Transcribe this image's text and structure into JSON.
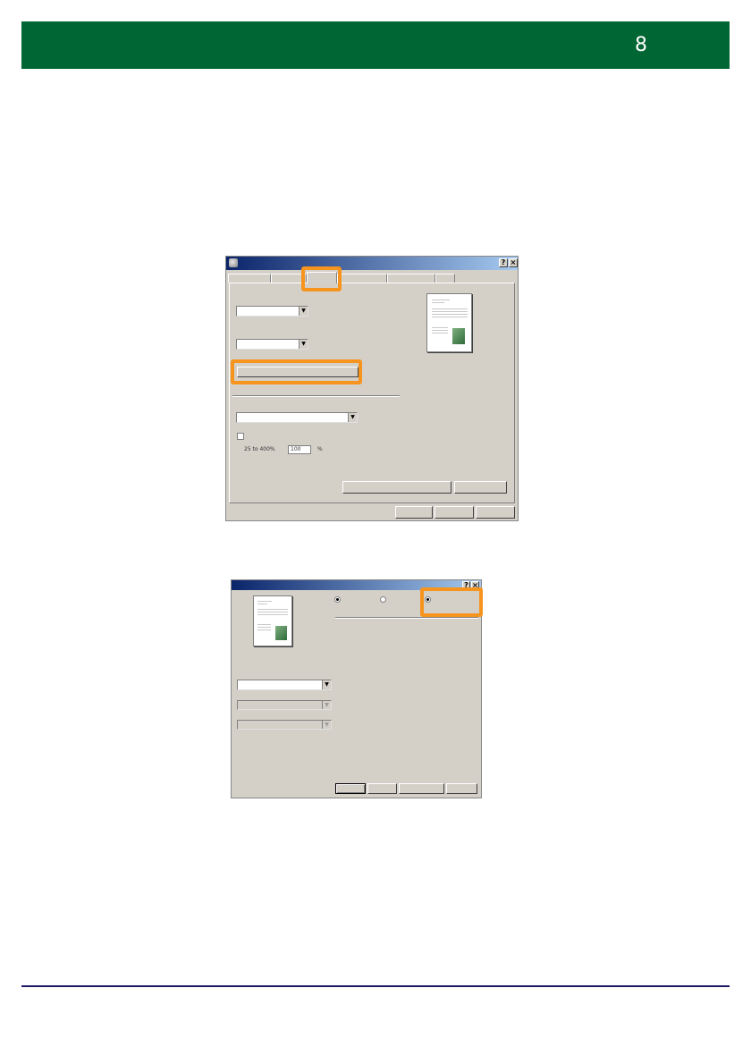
{
  "header": {
    "page_number": "8",
    "colors": {
      "header_bar": "#006633",
      "footer_rule": "#1a1a66",
      "highlight": "#f7941d"
    }
  },
  "dialog1": {
    "scale_range_text": "25 to 400%",
    "scale_value": "100",
    "scale_unit": "%",
    "icons": [
      "printer-icon",
      "help-icon",
      "close-icon"
    ]
  },
  "dialog2": {
    "icons": [
      "help-icon",
      "close-icon"
    ]
  }
}
